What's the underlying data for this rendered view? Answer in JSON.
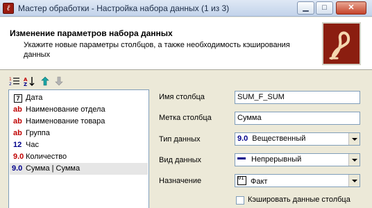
{
  "window": {
    "title": "Мастер обработки - Настройка набора данных (1 из 3)",
    "controls": {
      "minimize": "▁",
      "maximize": "□",
      "close": "✕"
    }
  },
  "header": {
    "title": "Изменение параметров набора данных",
    "description": "Укажите новые параметры столбцов, а также необходимость кэширования данных"
  },
  "toolbar": {
    "icons": [
      "list-order-icon",
      "sort-az-icon",
      "move-up-arrow-icon",
      "move-down-arrow-icon"
    ]
  },
  "columns": [
    {
      "icon": "7",
      "icon_kind": "date",
      "label": "Дата"
    },
    {
      "icon": "ab",
      "icon_kind": "string",
      "label": "Наименование отдела"
    },
    {
      "icon": "ab",
      "icon_kind": "string",
      "label": "Наименование товара"
    },
    {
      "icon": "ab",
      "icon_kind": "string",
      "label": "Группа"
    },
    {
      "icon": "12",
      "icon_kind": "integer",
      "label": "Час"
    },
    {
      "icon": "9.0",
      "icon_kind": "real-red",
      "label": "Количество"
    },
    {
      "icon": "9.0",
      "icon_kind": "real-blue",
      "label": "Сумма | Сумма",
      "selected": true
    }
  ],
  "form": {
    "column_name_label": "Имя столбца",
    "column_name_value": "SUM_F_SUM",
    "column_caption_label": "Метка столбца",
    "column_caption_value": "Сумма",
    "data_type_label": "Тип данных",
    "data_type_icon": "9.0",
    "data_type_value": "Вещественный",
    "data_kind_label": "Вид данных",
    "data_kind_value": "Непрерывный",
    "purpose_label": "Назначение",
    "purpose_icon": "01 10",
    "purpose_value": "Факт",
    "cache_label": "Кэшировать данные столбца",
    "cache_checked": false
  },
  "colors": {
    "string_icon": "#c00000",
    "integer_icon": "#00008b",
    "real_blue_icon": "#00008b",
    "selected_row": "#e6e6e6"
  }
}
